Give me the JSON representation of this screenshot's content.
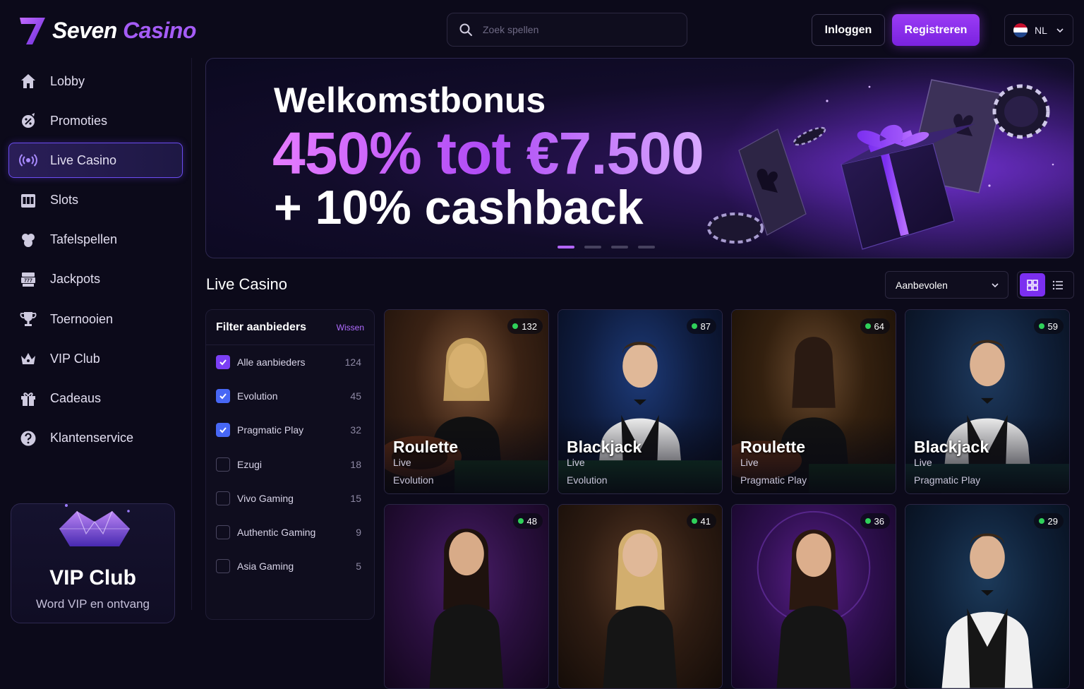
{
  "brand": {
    "name_part1": "Seven",
    "name_part2": "Casino"
  },
  "search": {
    "placeholder": "Zoek spellen"
  },
  "header": {
    "login_label": "Inloggen",
    "register_label": "Registreren",
    "language": "NL"
  },
  "sidebar": {
    "items": [
      {
        "label": "Lobby",
        "icon": "home-icon"
      },
      {
        "label": "Promoties",
        "icon": "promo-icon"
      },
      {
        "label": "Live Casino",
        "icon": "live-broadcast-icon",
        "active": true
      },
      {
        "label": "Slots",
        "icon": "slots-icon"
      },
      {
        "label": "Tafelspellen",
        "icon": "cards-icon"
      },
      {
        "label": "Jackpots",
        "icon": "jackpot-icon"
      },
      {
        "label": "Toernooien",
        "icon": "trophy-icon"
      },
      {
        "label": "VIP Club",
        "icon": "crown-icon"
      },
      {
        "label": "Cadeaus",
        "icon": "gift-icon"
      },
      {
        "label": "Klantenservice",
        "icon": "help-icon"
      }
    ],
    "vip_card": {
      "title": "VIP Club",
      "subtitle": "Word VIP en ontvang"
    }
  },
  "banner": {
    "line1": "Welkomstbonus",
    "line2": "450% tot €7.500",
    "line3": "+ 10% cashback",
    "slides": 4,
    "active_slide": 1
  },
  "section": {
    "title": "Live Casino",
    "sort_value": "Aanbevolen"
  },
  "filter": {
    "title": "Filter aanbieders",
    "clear_label": "Wissen",
    "providers": [
      {
        "name": "Alle aanbieders",
        "count": "124",
        "checked": true
      },
      {
        "name": "Evolution",
        "count": "45",
        "checked": true
      },
      {
        "name": "Pragmatic Play",
        "count": "32",
        "checked": true
      },
      {
        "name": "Ezugi",
        "count": "18",
        "checked": false
      },
      {
        "name": "Vivo Gaming",
        "count": "15",
        "checked": false
      },
      {
        "name": "Authentic Gaming",
        "count": "9",
        "checked": false
      },
      {
        "name": "Asia Gaming",
        "count": "5",
        "checked": false
      }
    ]
  },
  "games": [
    {
      "name": "Roulette",
      "type": "Live",
      "provider": "Evolution",
      "players": "132"
    },
    {
      "name": "Blackjack",
      "type": "Live",
      "provider": "Evolution",
      "players": "87"
    },
    {
      "name": "Roulette",
      "type": "Live",
      "provider": "Pragmatic Play",
      "players": "64"
    },
    {
      "name": "Blackjack",
      "type": "Live",
      "provider": "Pragmatic Play",
      "players": "59"
    },
    {
      "name": "",
      "type": "",
      "provider": "",
      "players": "48"
    },
    {
      "name": "",
      "type": "",
      "provider": "",
      "players": "41"
    },
    {
      "name": "",
      "type": "",
      "provider": "",
      "players": "36"
    },
    {
      "name": "",
      "type": "",
      "provider": "",
      "players": "29"
    }
  ],
  "colors": {
    "accent": "#8b2ff5",
    "brand_purple": "#a55cf6",
    "live_dot": "#2fd15a",
    "background": "#0c0a1a"
  }
}
